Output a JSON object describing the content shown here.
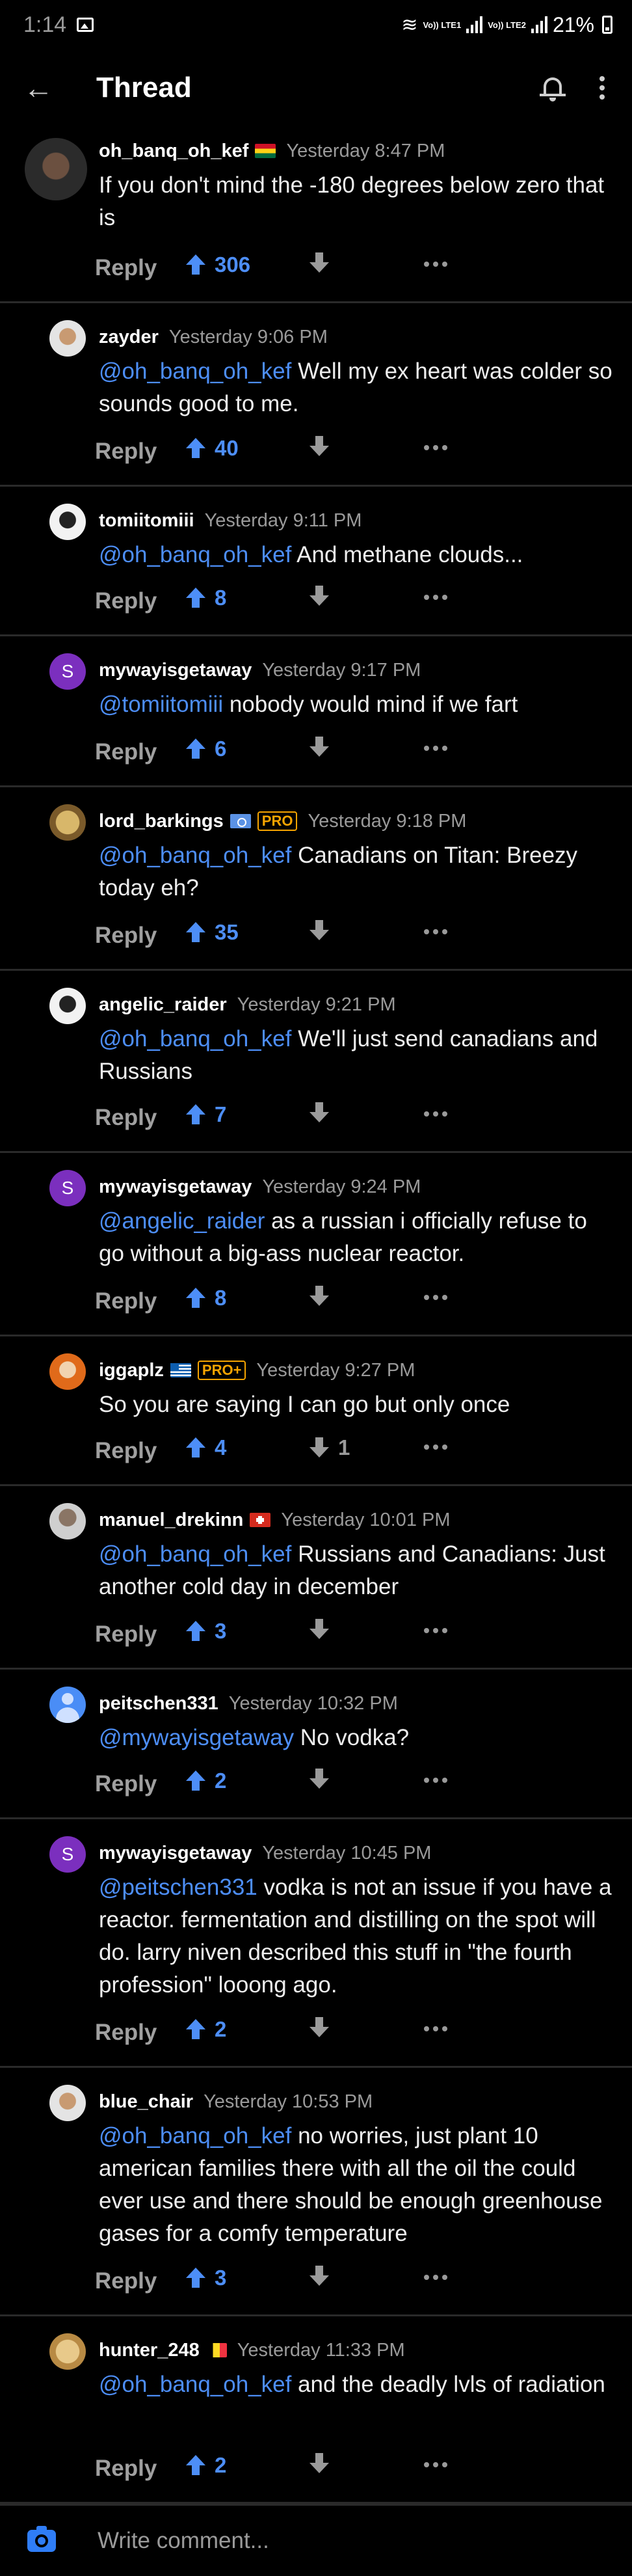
{
  "status_bar": {
    "time": "1:14",
    "sim1": "Vo)) LTE1",
    "sim2": "Vo)) LTE2",
    "battery": "21%"
  },
  "app_bar": {
    "title": "Thread"
  },
  "comments": [
    {
      "username": "oh_banq_oh_kef",
      "flag": "ghana",
      "time": "Yesterday 8:47 PM",
      "mention": "",
      "text": "If you don't mind the -180 degrees below zero that is",
      "upvotes": "306",
      "downvotes": ""
    },
    {
      "username": "zayder",
      "time": "Yesterday 9:06 PM",
      "mention": "@oh_banq_oh_kef",
      "text": " Well my ex heart was colder so sounds good to me.",
      "upvotes": "40",
      "downvotes": ""
    },
    {
      "username": "tomiitomiii",
      "time": "Yesterday 9:11 PM",
      "mention": "@oh_banq_oh_kef",
      "text": " And methane clouds...",
      "upvotes": "8",
      "downvotes": ""
    },
    {
      "username": "mywayisgetaway",
      "avatar_letter": "S",
      "time": "Yesterday 9:17 PM",
      "mention": "@tomiitomiii",
      "text": " nobody would mind if we fart",
      "upvotes": "6",
      "downvotes": ""
    },
    {
      "username": "lord_barkings",
      "flag": "un",
      "badge": "PRO",
      "time": "Yesterday 9:18 PM",
      "mention": "@oh_banq_oh_kef",
      "text": " Canadians on Titan: Breezy today eh?",
      "upvotes": "35",
      "downvotes": ""
    },
    {
      "username": "angelic_raider",
      "time": "Yesterday 9:21 PM",
      "mention": "@oh_banq_oh_kef",
      "text": " We'll just send canadians and Russians",
      "upvotes": "7",
      "downvotes": ""
    },
    {
      "username": "mywayisgetaway",
      "avatar_letter": "S",
      "time": "Yesterday 9:24 PM",
      "mention": "@angelic_raider",
      "text": " as a russian i officially refuse to go without a big-ass nuclear reactor.",
      "upvotes": "8",
      "downvotes": ""
    },
    {
      "username": "iggaplz",
      "flag": "greece",
      "badge": "PRO+",
      "time": "Yesterday 9:27 PM",
      "mention": "",
      "text": "So you are saying I can go but only once",
      "upvotes": "4",
      "downvotes": "1"
    },
    {
      "username": "manuel_drekinn",
      "flag": "switzerland",
      "time": "Yesterday 10:01 PM",
      "mention": "@oh_banq_oh_kef",
      "text": " Russians and Canadians: Just another cold day in december",
      "upvotes": "3",
      "downvotes": ""
    },
    {
      "username": "peitschen331",
      "time": "Yesterday 10:32 PM",
      "mention": "@mywayisgetaway",
      "text": " No vodka?",
      "upvotes": "2",
      "downvotes": ""
    },
    {
      "username": "mywayisgetaway",
      "avatar_letter": "S",
      "time": "Yesterday 10:45 PM",
      "mention": "@peitschen331",
      "text": " vodka is not an issue if you have a reactor. fermentation and distilling on the spot will do. larry niven described this stuff in \"the fourth profession\" looong ago.",
      "upvotes": "2",
      "downvotes": ""
    },
    {
      "username": "blue_chair",
      "time": "Yesterday 10:53 PM",
      "mention": "@oh_banq_oh_kef",
      "text": " no worries, just plant 10 american families there with all the oil the could ever use and there should be enough greenhouse gases for a comfy temperature",
      "upvotes": "3",
      "downvotes": ""
    },
    {
      "username": "hunter_248",
      "flag": "belgium",
      "time": "Yesterday 11:33 PM",
      "mention": "@oh_banq_oh_kef",
      "text": " and the deadly lvls of radiation",
      "upvotes": "2",
      "downvotes": ""
    }
  ],
  "labels": {
    "reply": "Reply"
  },
  "composer": {
    "placeholder": "Write comment..."
  },
  "colors": {
    "accent": "#4d8ef7",
    "background": "#000000",
    "divider": "#2a2a2a",
    "badge": "#f6a400"
  }
}
